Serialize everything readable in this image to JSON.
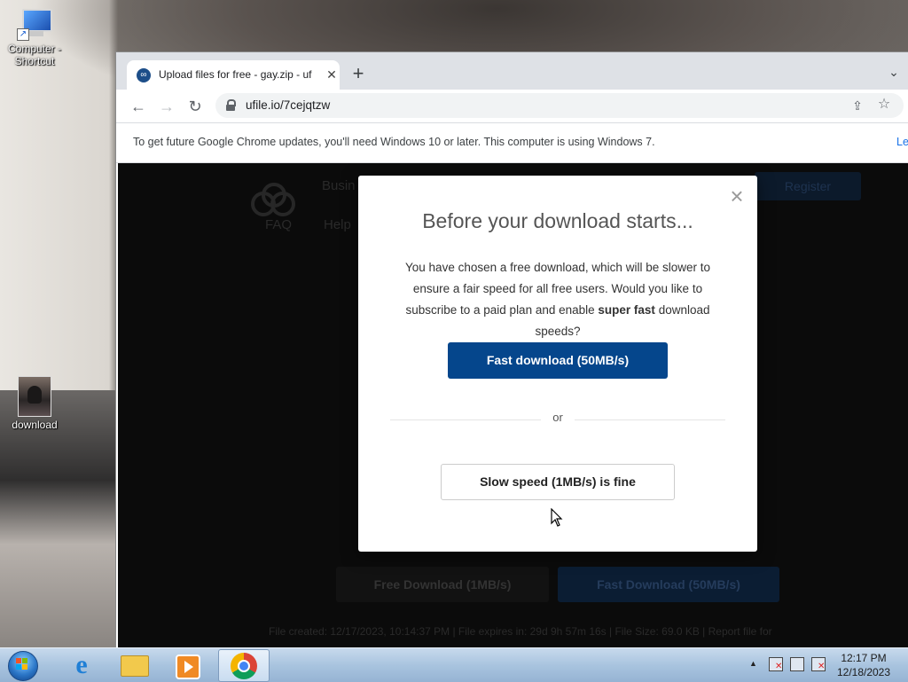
{
  "desktop": {
    "icons": [
      {
        "label": "Computer - Shortcut"
      },
      {
        "label": "download"
      }
    ]
  },
  "browser": {
    "tab": {
      "title": "Upload files for free - gay.zip - uf",
      "favicon": "ufile-icon"
    },
    "address": {
      "url": "ufile.io/7cejqtzw"
    },
    "infobar": {
      "message": "To get future Google Chrome updates, you'll need Windows 10 or later. This computer is using Windows 7.",
      "link": "Le"
    }
  },
  "page": {
    "nav": {
      "business": "Busin",
      "faq": "FAQ",
      "help": "Help",
      "register": "Register"
    },
    "buttons": {
      "free": "Free Download (1MB/s)",
      "fast": "Fast Download (50MB/s)"
    },
    "footer_text": "File created: 12/17/2023, 10:14:37 PM  |  File expires in: 29d 9h 57m 16s  |  File Size: 69.0 KB  |  Report file for"
  },
  "modal": {
    "title": "Before your download starts...",
    "body_pre": "You have chosen a free download, which will be slower to ensure a fair speed for all free users. Would you like to subscribe to a paid plan and enable ",
    "body_bold": "super fast",
    "body_post": " download speeds?",
    "fast_button": "Fast download (50MB/s)",
    "or": "or",
    "slow_button": "Slow speed (1MB/s) is fine"
  },
  "taskbar": {
    "clock_time": "12:17 PM",
    "clock_date": "12/18/2023",
    "tray_arrow": "▲"
  },
  "colors": {
    "accent": "#05468c",
    "page_bg": "#0b0b0b",
    "modal_bg": "#ffffff"
  }
}
